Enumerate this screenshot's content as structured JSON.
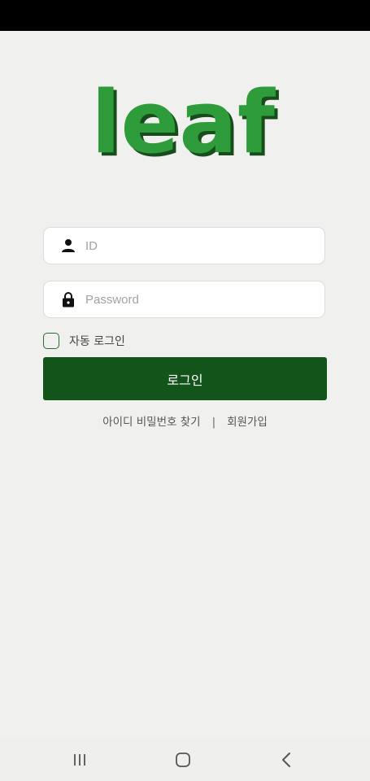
{
  "app": {
    "logo_text": "leaf"
  },
  "form": {
    "id_placeholder": "ID",
    "password_placeholder": "Password",
    "auto_login_label": "자동 로그인",
    "auto_login_checked": false,
    "login_button_label": "로그인"
  },
  "links": {
    "find_account": "아이디 비밀번호 찾기",
    "separator": "|",
    "signup": "회원가입"
  },
  "icons": {
    "id_field": "person-icon",
    "password_field": "lock-icon",
    "nav_recent": "recent-apps-icon",
    "nav_home": "home-icon",
    "nav_back": "back-icon"
  },
  "colors": {
    "background": "#f0f1ef",
    "primary": "#12541a",
    "logo_green": "#2e9c3a",
    "logo_shadow": "#174d1c"
  }
}
